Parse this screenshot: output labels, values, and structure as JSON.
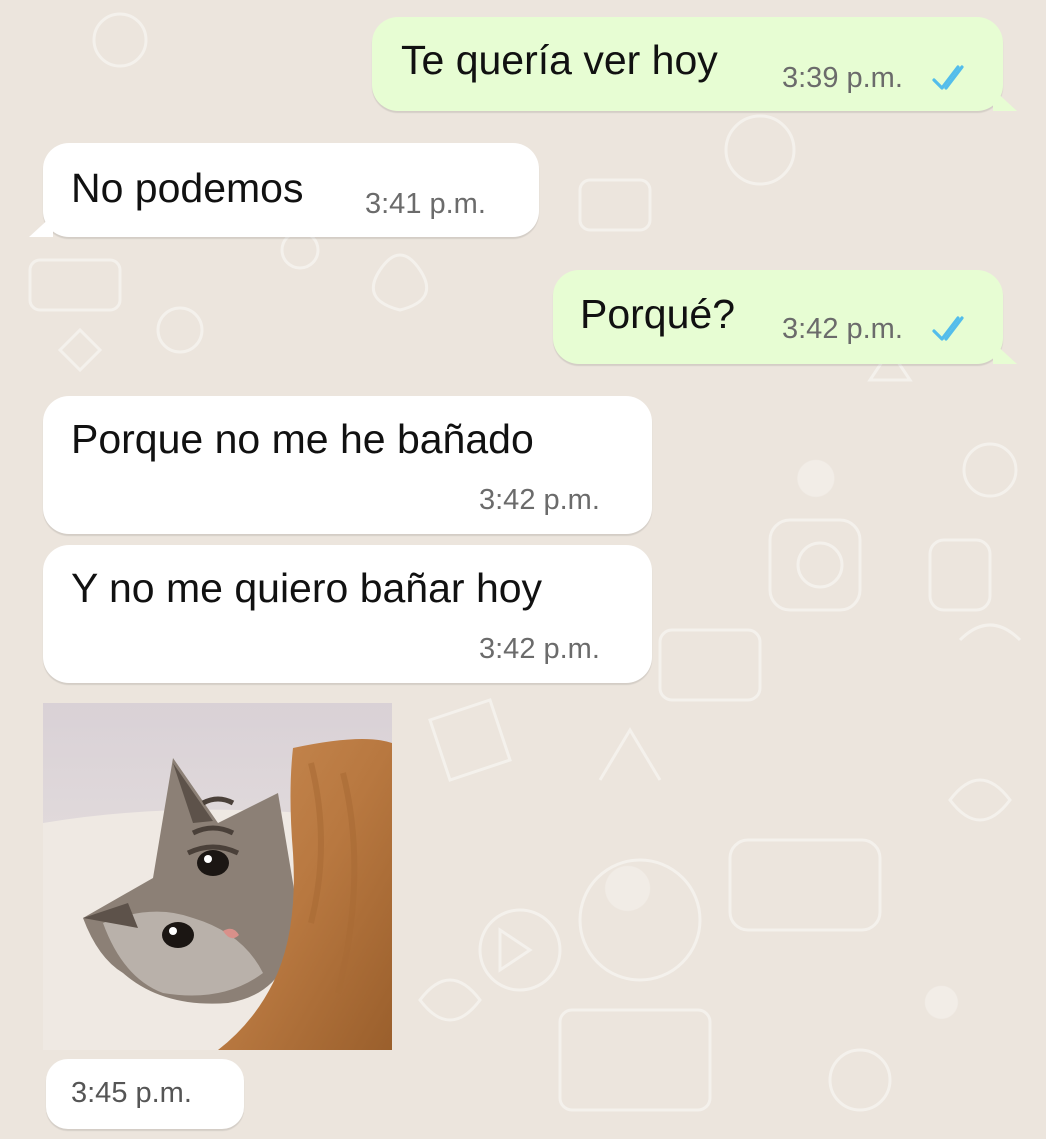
{
  "chat": {
    "messages": [
      {
        "direction": "outgoing",
        "text": "Te quería ver hoy",
        "time": "3:39 p.m.",
        "status": "read-double-check"
      },
      {
        "direction": "incoming",
        "text": "No podemos",
        "time": "3:41 p.m."
      },
      {
        "direction": "outgoing",
        "text": "Porqué?",
        "time": "3:42 p.m.",
        "status": "read-double-check"
      },
      {
        "direction": "incoming",
        "text": "Porque no me he bañado",
        "time": "3:42 p.m."
      },
      {
        "direction": "incoming",
        "text": "Y no me quiero bañar hoy",
        "time": "3:42 p.m."
      },
      {
        "direction": "incoming",
        "type": "image",
        "image_subject": "crying-kitten-under-blanket",
        "time": "3:45 p.m."
      }
    ]
  },
  "colors": {
    "background": "#ece5dd",
    "outgoing_bubble": "#e7fdd3",
    "incoming_bubble": "#ffffff",
    "read_ticks": "#53bdeb",
    "timestamp": "#6b6b6b"
  },
  "icons": {
    "read_receipt": "double-check-icon"
  }
}
